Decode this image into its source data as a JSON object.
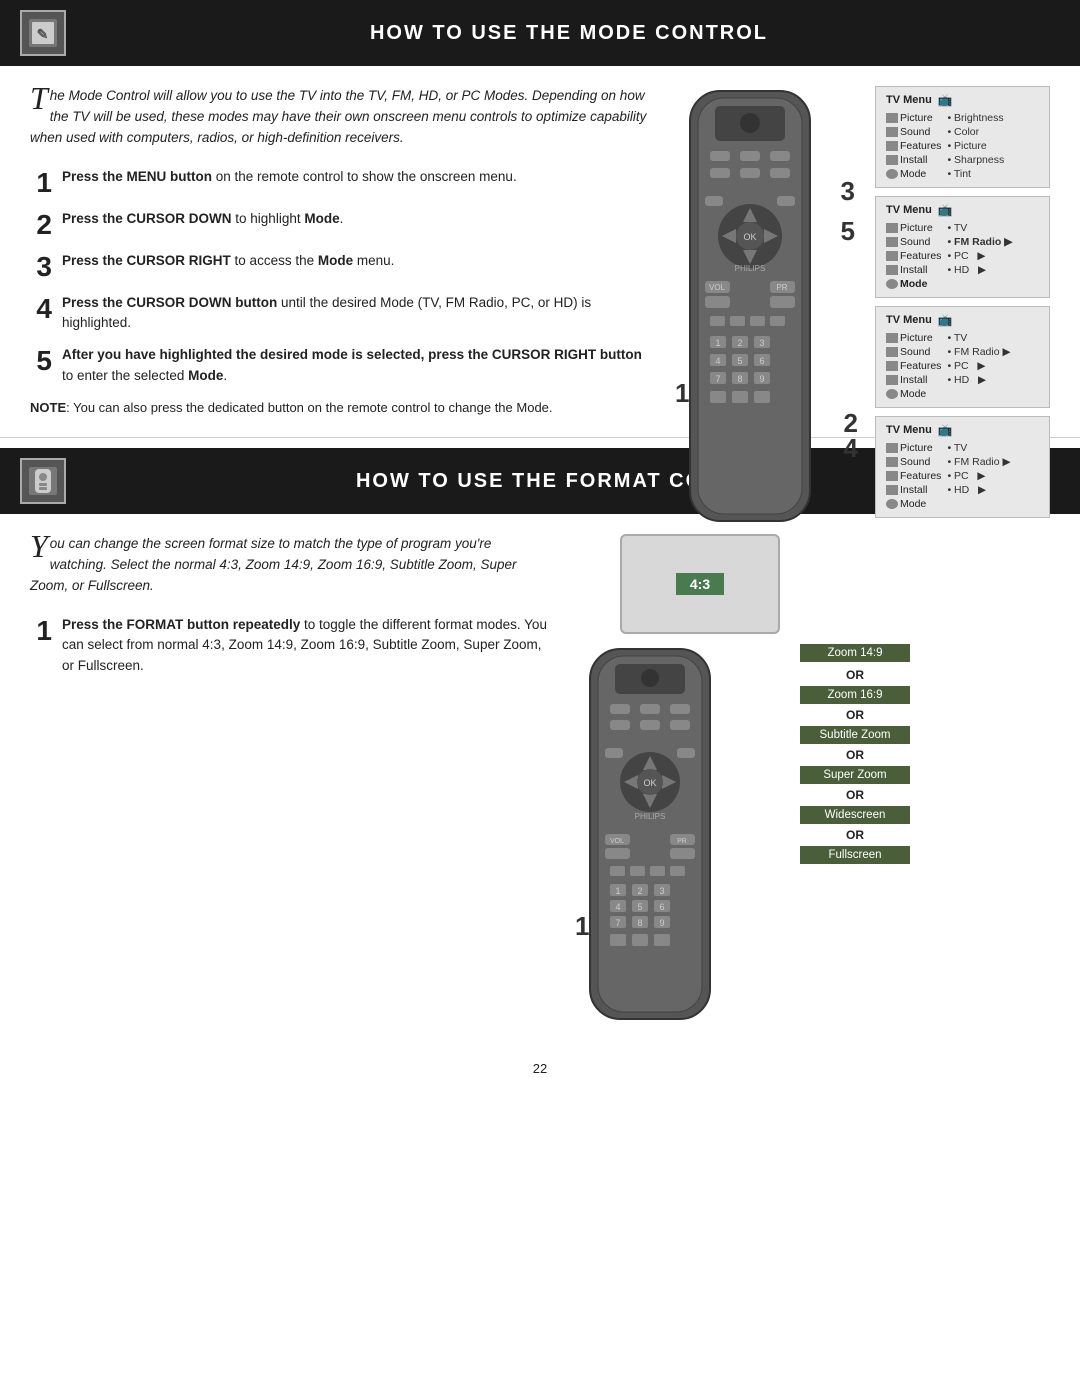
{
  "page": {
    "number": "22"
  },
  "mode_section": {
    "header_title": "HOW TO USE THE MODE CONTROL",
    "header_icon": "✎",
    "intro": {
      "drop_cap": "T",
      "text": "he Mode Control will allow you to use the TV into the TV, FM, HD, or PC Modes. Depending on how the TV will be used, these modes may have their own onscreen menu controls to optimize capability when used with computers, radios, or high-definition receivers."
    },
    "steps": [
      {
        "number": "1",
        "text": "Press the MENU button on the remote control to show the onscreen menu."
      },
      {
        "number": "2",
        "text": "Press the CURSOR DOWN to highlight Mode."
      },
      {
        "number": "3",
        "text": "Press the CURSOR RIGHT to access the Mode menu."
      },
      {
        "number": "4",
        "text": "Press the CURSOR DOWN button until the desired Mode (TV, FM Radio, PC, or HD) is highlighted."
      },
      {
        "number": "5",
        "text": "After you have highlighted the desired mode is selected, press the CURSOR RIGHT button to enter the selected Mode."
      }
    ],
    "note": "NOTE: You can also press the dedicated button on the remote control to change the Mode.",
    "tv_menus": [
      {
        "title": "TV Menu",
        "rows": [
          {
            "label": "Picture",
            "items": [
              "• Brightness"
            ]
          },
          {
            "label": "Sound",
            "items": [
              "• Color"
            ]
          },
          {
            "label": "Features",
            "items": [
              "• Picture"
            ]
          },
          {
            "label": "Install",
            "items": [
              "• Sharpness"
            ]
          },
          {
            "label": "Mode",
            "items": [
              "• Tint"
            ]
          }
        ]
      },
      {
        "title": "TV Menu",
        "rows": [
          {
            "label": "Picture",
            "items": [
              "• TV"
            ]
          },
          {
            "label": "Sound",
            "items": [
              "• FM Radio ▶"
            ],
            "bold": true
          },
          {
            "label": "Features",
            "items": [
              "• PC  ▶"
            ]
          },
          {
            "label": "Install",
            "items": [
              "• HD  ▶"
            ]
          },
          {
            "label": "Mode",
            "items": []
          }
        ]
      },
      {
        "title": "TV Menu",
        "rows": [
          {
            "label": "Picture",
            "items": [
              "• TV"
            ]
          },
          {
            "label": "Sound",
            "items": [
              "• FM Radio ▶"
            ]
          },
          {
            "label": "Features",
            "items": [
              "• PC  ▶"
            ]
          },
          {
            "label": "Install",
            "items": [
              "• HD  ▶"
            ]
          },
          {
            "label": "Mode",
            "items": []
          }
        ]
      },
      {
        "title": "TV Menu",
        "rows": [
          {
            "label": "Picture",
            "items": [
              "• TV"
            ]
          },
          {
            "label": "Sound",
            "items": [
              "• FM Radio ▶"
            ]
          },
          {
            "label": "Features",
            "items": [
              "• PC  ▶"
            ]
          },
          {
            "label": "Install",
            "items": [
              "• HD  ▶"
            ]
          },
          {
            "label": "Mode",
            "items": []
          }
        ]
      }
    ]
  },
  "format_section": {
    "header_title": "HOW TO USE THE FORMAT CONTROL",
    "header_icon": "📱",
    "intro": {
      "drop_cap": "Y",
      "text": "ou can change the screen format size to match the type of program you're watching. Select the normal 4:3, Zoom 14:9, Zoom 16:9, Subtitle Zoom, Super Zoom, or Fullscreen."
    },
    "steps": [
      {
        "number": "1",
        "text": "Press the FORMAT button repeatedly to toggle the different format modes. You can select from normal 4:3, Zoom 14:9, Zoom 16:9, Subtitle Zoom, Super Zoom, or Fullscreen."
      }
    ],
    "screen_label": "4:3",
    "zoom_options": [
      {
        "label": "Zoom 14:9",
        "separator": ""
      },
      {
        "label": "OR",
        "type": "or"
      },
      {
        "label": "Zoom 16:9"
      },
      {
        "label": "OR",
        "type": "or"
      },
      {
        "label": "Subtitle Zoom"
      },
      {
        "label": "OR",
        "type": "or"
      },
      {
        "label": "Super Zoom"
      },
      {
        "label": "OR",
        "type": "or"
      },
      {
        "label": "Widescreen"
      },
      {
        "label": "OR",
        "type": "or"
      },
      {
        "label": "Fullscreen"
      }
    ]
  }
}
